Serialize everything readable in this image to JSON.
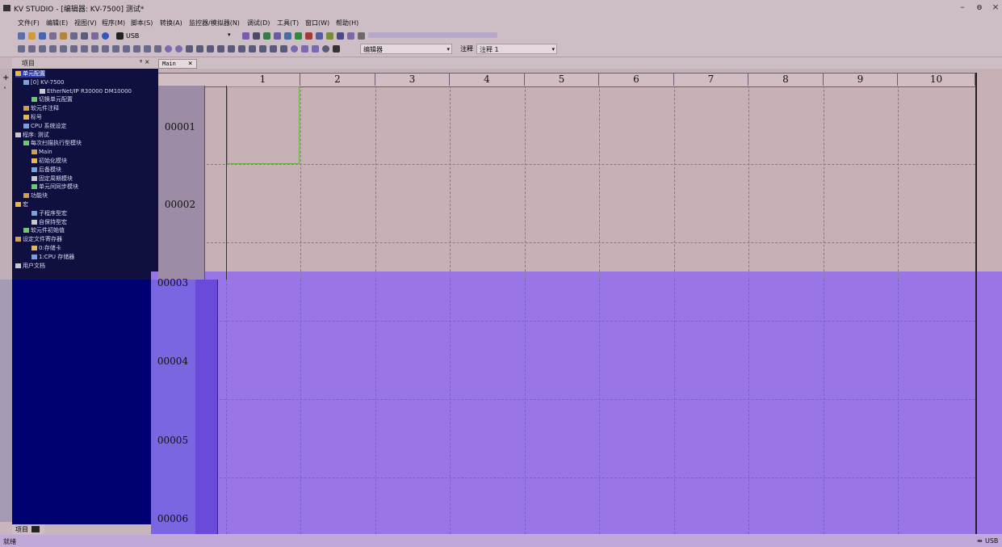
{
  "window": {
    "title": "KV STUDIO - [编辑器: KV-7500] 测试*",
    "minimize": "–",
    "restore": "ɵ",
    "close": "×"
  },
  "menu": [
    "文件(F)",
    "编辑(E)",
    "视图(V)",
    "程序(M)",
    "脚本(S)",
    "转换(A)",
    "监控器/模拟器(N)",
    "调试(D)",
    "工具(T)",
    "窗口(W)",
    "帮助(H)"
  ],
  "toolbar": {
    "connection": "USB",
    "mode_select": "编辑器",
    "comment_label": "注释",
    "comment_select": "注释 1"
  },
  "project_panel": {
    "title": "项目",
    "pin": "ᵠ ×"
  },
  "tree": [
    {
      "label": "单元配置",
      "indent": 0,
      "selected": true
    },
    {
      "label": "[0]  KV-7500",
      "indent": 1
    },
    {
      "label": "EtherNet/IP  R30000  DM10000",
      "indent": 3
    },
    {
      "label": "切换单元配置",
      "indent": 2
    },
    {
      "label": "软元件注释",
      "indent": 1
    },
    {
      "label": "标号",
      "indent": 1
    },
    {
      "label": "CPU 系统设定",
      "indent": 1
    },
    {
      "label": "程序: 测试",
      "indent": 0
    },
    {
      "label": "每次扫描执行型模块",
      "indent": 1
    },
    {
      "label": "Main",
      "indent": 2
    },
    {
      "label": "初始化模块",
      "indent": 2
    },
    {
      "label": "后备模块",
      "indent": 2
    },
    {
      "label": "固定周期模块",
      "indent": 2
    },
    {
      "label": "单元间同步模块",
      "indent": 2
    },
    {
      "label": "功能块",
      "indent": 1
    },
    {
      "label": "宏",
      "indent": 0
    },
    {
      "label": "子程序型宏",
      "indent": 2
    },
    {
      "label": "自保持型宏",
      "indent": 2
    },
    {
      "label": "软元件初始值",
      "indent": 1
    },
    {
      "label": "设定文件寄存器",
      "indent": 0
    },
    {
      "label": "0:存储卡",
      "indent": 2
    },
    {
      "label": "1:CPU 存储器",
      "indent": 2
    },
    {
      "label": "用户文档",
      "indent": 0
    }
  ],
  "editor": {
    "tab_label": "Main",
    "tab_close": "×",
    "columns": [
      "1",
      "2",
      "3",
      "4",
      "5",
      "6",
      "7",
      "8",
      "9",
      "10"
    ],
    "rows": [
      "00001",
      "00002",
      "00003",
      "00004",
      "00005",
      "00006"
    ]
  },
  "side_tab": "项目",
  "status": {
    "text": "就绪",
    "connection": "USB"
  },
  "colors": {
    "tree_bg": "#101040",
    "editor_upper": "#c8b1b5",
    "editor_lower": "#9a75e6",
    "selected_cell": "#6fa84a"
  }
}
